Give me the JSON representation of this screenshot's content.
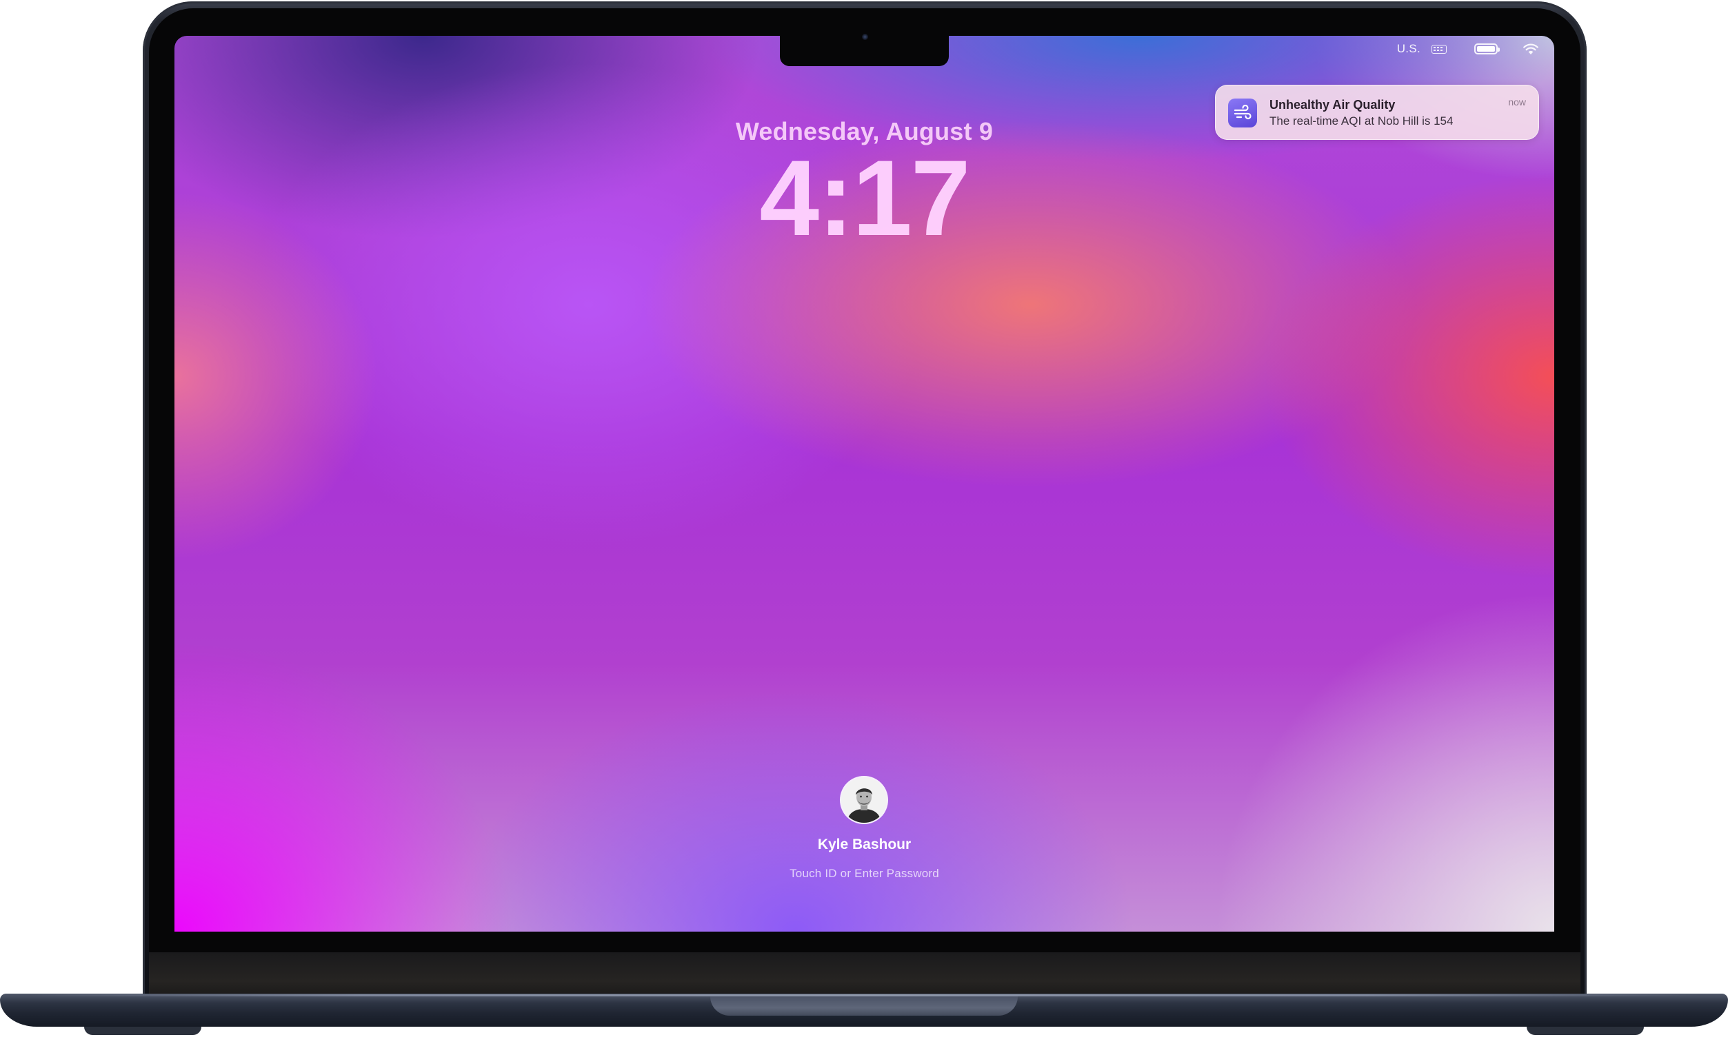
{
  "menubar": {
    "input_source": "U.S.",
    "icons": [
      "keyboard-icon",
      "battery-icon",
      "wifi-icon"
    ]
  },
  "lock_screen": {
    "date": "Wednesday, August 9",
    "time": "4:17"
  },
  "notification": {
    "app_icon": "wind-icon",
    "title": "Unhealthy Air Quality",
    "body": "The real-time AQI at Nob Hill is 154",
    "time": "now"
  },
  "user": {
    "name": "Kyle Bashour",
    "prompt": "Touch ID or Enter Password"
  },
  "colors": {
    "device": "#1c2230",
    "notification_icon": "#6a56e0"
  }
}
